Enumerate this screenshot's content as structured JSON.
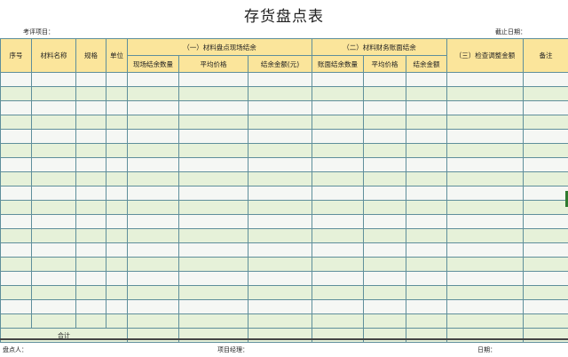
{
  "title": "存货盘点表",
  "header": {
    "project_label": "考评项目：",
    "deadline_label": "截止日期："
  },
  "table": {
    "col_seq": "序号",
    "col_name": "材料名称",
    "col_spec": "规格",
    "col_unit": "单位",
    "group1": "（一）材料盘点现场结余",
    "group1_sub": [
      "现场结余数量",
      "平均价格",
      "结余金额(元)"
    ],
    "group2": "（二）材料财务账面结余",
    "group2_sub": [
      "账面结余数量",
      "平均价格",
      "结余金额"
    ],
    "group3": "（三）检查调整金额",
    "col_remark": "备注",
    "total_label": "合计"
  },
  "footer": {
    "counter_label": "盘点人：",
    "manager_label": "项目经理：",
    "date_label": "日期："
  }
}
